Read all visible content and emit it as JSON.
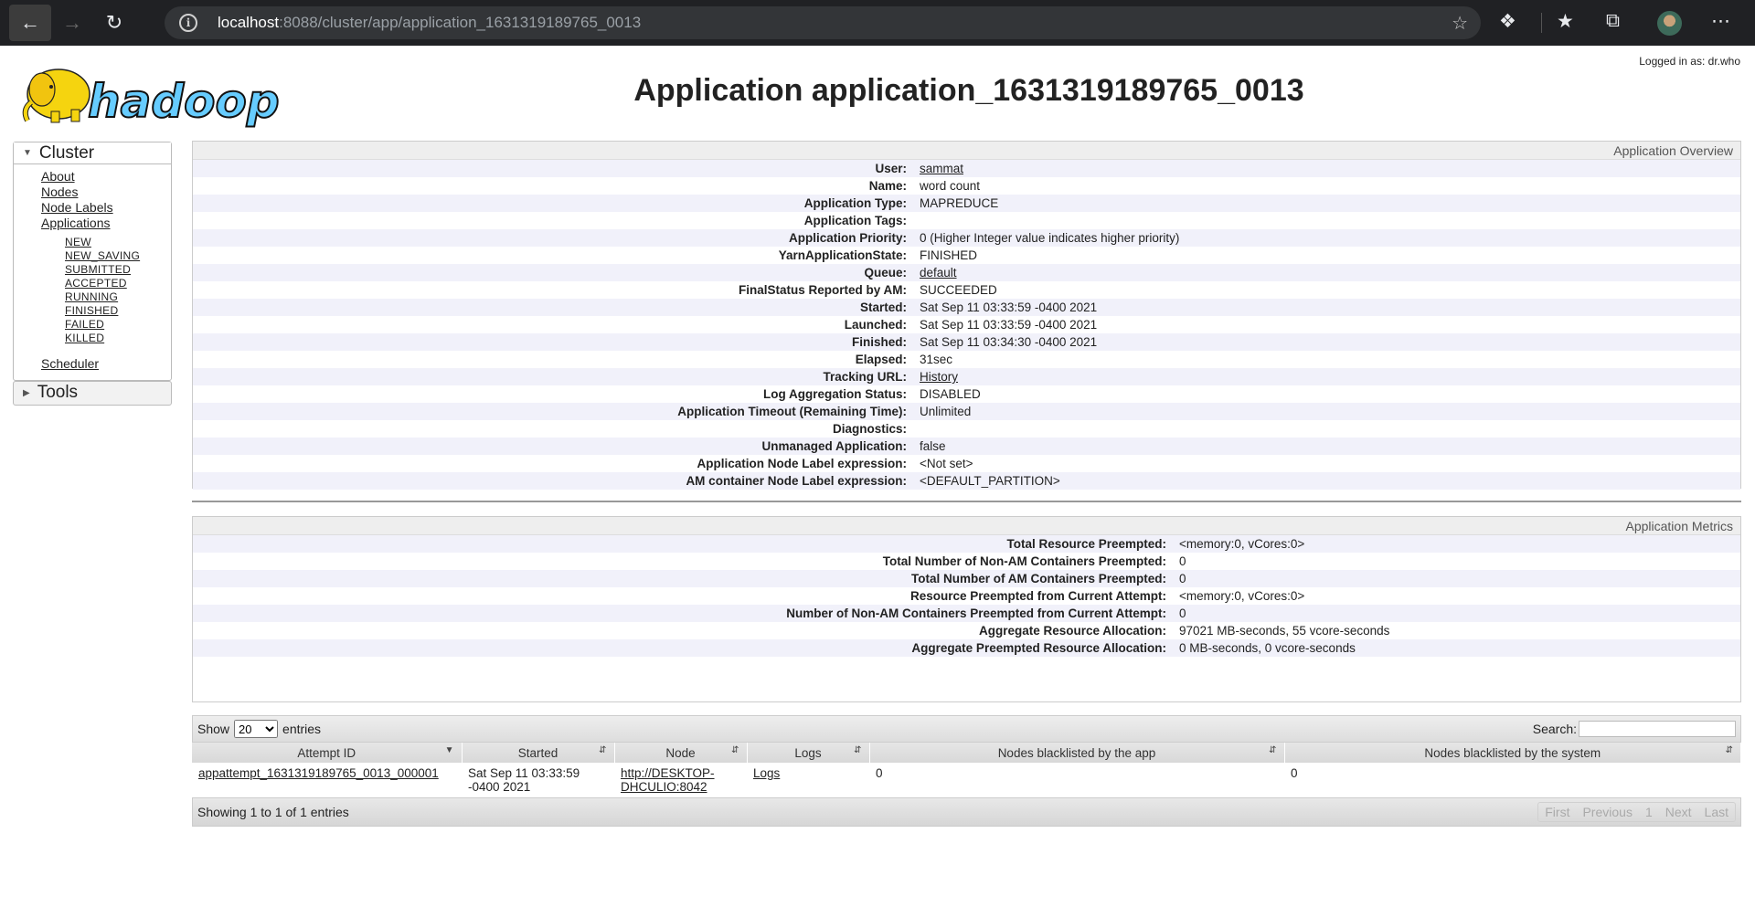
{
  "browser": {
    "url_host": "localhost",
    "url_path": ":8088/cluster/app/application_1631319189765_0013"
  },
  "header": {
    "logged_in": "Logged in as: dr.who",
    "title": "Application application_1631319189765_0013",
    "logo_text": "hadoop"
  },
  "sidebar": {
    "cluster_label": "Cluster",
    "items": [
      "About",
      "Nodes",
      "Node Labels",
      "Applications"
    ],
    "app_states": [
      "NEW",
      "NEW_SAVING",
      "SUBMITTED",
      "ACCEPTED",
      "RUNNING",
      "FINISHED",
      "FAILED",
      "KILLED"
    ],
    "scheduler": "Scheduler",
    "tools_label": "Tools"
  },
  "overview": {
    "title": "Application Overview",
    "rows": [
      {
        "k": "User:",
        "v": "sammat"
      },
      {
        "k": "Name:",
        "v": "word count"
      },
      {
        "k": "Application Type:",
        "v": "MAPREDUCE"
      },
      {
        "k": "Application Tags:",
        "v": ""
      },
      {
        "k": "Application Priority:",
        "v": "0 (Higher Integer value indicates higher priority)"
      },
      {
        "k": "YarnApplicationState:",
        "v": "FINISHED"
      },
      {
        "k": "Queue:",
        "v": "default"
      },
      {
        "k": "FinalStatus Reported by AM:",
        "v": "SUCCEEDED"
      },
      {
        "k": "Started:",
        "v": "Sat Sep 11 03:33:59 -0400 2021"
      },
      {
        "k": "Launched:",
        "v": "Sat Sep 11 03:33:59 -0400 2021"
      },
      {
        "k": "Finished:",
        "v": "Sat Sep 11 03:34:30 -0400 2021"
      },
      {
        "k": "Elapsed:",
        "v": "31sec"
      },
      {
        "k": "Tracking URL:",
        "v": "History"
      },
      {
        "k": "Log Aggregation Status:",
        "v": "DISABLED"
      },
      {
        "k": "Application Timeout (Remaining Time):",
        "v": "Unlimited"
      },
      {
        "k": "Diagnostics:",
        "v": ""
      },
      {
        "k": "Unmanaged Application:",
        "v": "false"
      },
      {
        "k": "Application Node Label expression:",
        "v": "<Not set>"
      },
      {
        "k": "AM container Node Label expression:",
        "v": "<DEFAULT_PARTITION>"
      }
    ]
  },
  "metrics": {
    "title": "Application Metrics",
    "rows": [
      {
        "k": "Total Resource Preempted:",
        "v": "<memory:0, vCores:0>"
      },
      {
        "k": "Total Number of Non-AM Containers Preempted:",
        "v": "0"
      },
      {
        "k": "Total Number of AM Containers Preempted:",
        "v": "0"
      },
      {
        "k": "Resource Preempted from Current Attempt:",
        "v": "<memory:0, vCores:0>"
      },
      {
        "k": "Number of Non-AM Containers Preempted from Current Attempt:",
        "v": "0"
      },
      {
        "k": "Aggregate Resource Allocation:",
        "v": "97021 MB-seconds, 55 vcore-seconds"
      },
      {
        "k": "Aggregate Preempted Resource Allocation:",
        "v": "0 MB-seconds, 0 vcore-seconds"
      }
    ]
  },
  "attempts": {
    "show_label": "Show",
    "entries_count": "20",
    "entries_label": "entries",
    "search_label": "Search:",
    "columns": [
      "Attempt ID",
      "Started",
      "Node",
      "Logs",
      "Nodes blacklisted by the app",
      "Nodes blacklisted by the system"
    ],
    "row": {
      "attempt_id": "appattempt_1631319189765_0013_000001",
      "started": "Sat Sep 11 03:33:59 -0400 2021",
      "node": "http://DESKTOP-DHCULIO:8042",
      "logs": "Logs",
      "bl_app": "0",
      "bl_system": "0"
    },
    "footer": "Showing 1 to 1 of 1 entries",
    "pager": [
      "First",
      "Previous",
      "1",
      "Next",
      "Last"
    ]
  }
}
